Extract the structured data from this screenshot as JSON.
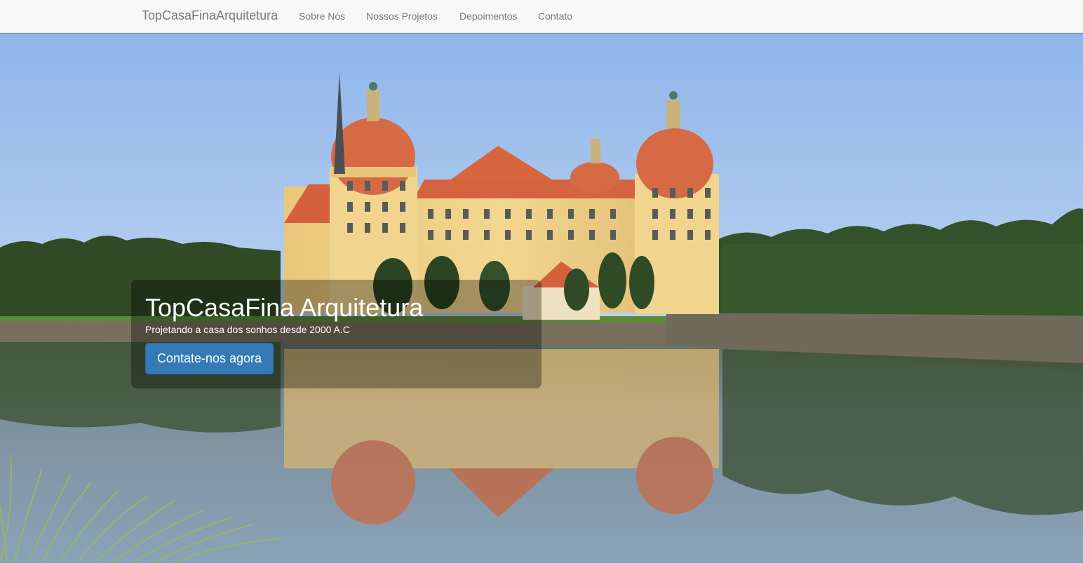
{
  "navbar": {
    "brand": "TopCasaFinaArquitetura",
    "links": [
      {
        "label": "Sobre Nós"
      },
      {
        "label": "Nossos Projetos"
      },
      {
        "label": "Depoimentos"
      },
      {
        "label": "Contato"
      }
    ]
  },
  "hero": {
    "image_description_icon": "castle-photo",
    "title": "TopCasaFina Arquitetura",
    "subtitle": "Projetando a casa dos sonhos desde 2000 A.C",
    "cta_label": "Contate-nos agora"
  },
  "colors": {
    "navbar_bg": "#f8f8f8",
    "nav_text": "#777777",
    "cta_bg": "#337ab7",
    "caption_overlay": "rgba(0,0,0,0.32)"
  }
}
